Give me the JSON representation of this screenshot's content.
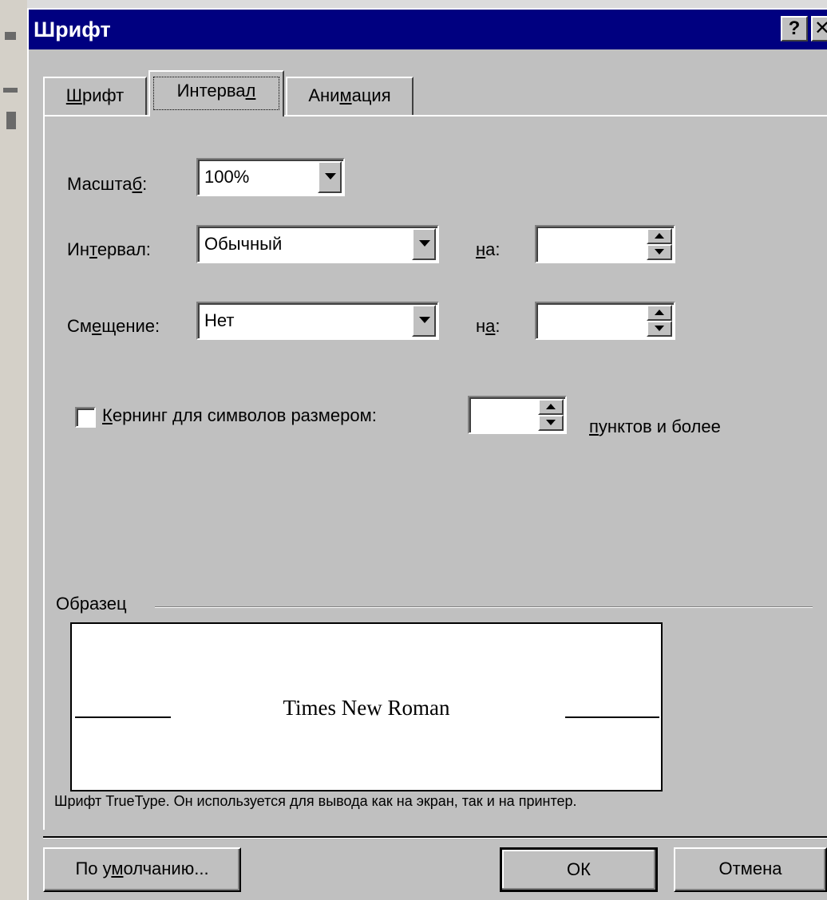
{
  "window": {
    "title": "Шрифт",
    "help_glyph": "?",
    "close_glyph": "✕"
  },
  "tabs": [
    {
      "label": "Шрифт",
      "accel": "Ш",
      "rest": "рифт",
      "active": false
    },
    {
      "label": "Интервал",
      "pre": "Интерва",
      "accel": "л",
      "active": true
    },
    {
      "label": "Анимация",
      "pre": "Ани",
      "accel": "м",
      "rest": "ация",
      "active": false
    }
  ],
  "scale": {
    "pre": "Масшта",
    "accel": "б",
    "post": ":",
    "value": "100%"
  },
  "interval": {
    "pre": "Ин",
    "accel": "т",
    "rest": "ервал:",
    "value": "Обычный",
    "by_accel": "н",
    "by_rest": "а:",
    "by_value": ""
  },
  "offset": {
    "pre": "См",
    "accel": "е",
    "rest": "щение:",
    "value": "Нет",
    "by_pre": "н",
    "by_accel": "а",
    "by_post": ":",
    "by_value": ""
  },
  "kerning": {
    "accel": "К",
    "rest": "ернинг для символов размером:",
    "checked": false,
    "value": "",
    "suffix_accel": "п",
    "suffix_rest": "унктов и более"
  },
  "sample": {
    "group_label": "Образец",
    "preview_text": "Times New Roman",
    "description": "Шрифт TrueType. Он используется для вывода как на экран, так и на принтер."
  },
  "buttons": {
    "default_pre": "По у",
    "default_accel": "м",
    "default_rest": "олчанию...",
    "ok": "ОК",
    "cancel": "Отмена"
  },
  "colors": {
    "titlebar": "#000080",
    "face": "#c0c0c0"
  }
}
